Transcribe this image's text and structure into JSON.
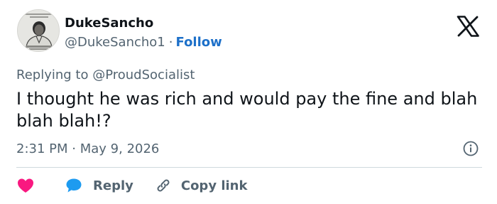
{
  "tweet": {
    "author_name": "DukeSancho",
    "author_handle": "@DukeSancho1",
    "separator": "·",
    "follow_label": "Follow",
    "replying_prefix": "Replying to",
    "replying_to": "@ProudSocialist",
    "text": "I thought he was rich and would pay the fine and blah blah blah!?",
    "time": "2:31 PM",
    "date": "May 9, 2026"
  },
  "actions": {
    "reply_label": "Reply",
    "copy_link_label": "Copy link"
  },
  "icons": {
    "brand": "x-logo-icon",
    "info": "info-icon",
    "like": "heart-icon",
    "reply": "speech-bubble-icon",
    "copy": "link-icon"
  },
  "colors": {
    "like": "#f91880",
    "reply": "#1d9bf0",
    "follow": "#1d70c9",
    "secondary_text": "#536471",
    "primary_text": "#0f1419"
  }
}
